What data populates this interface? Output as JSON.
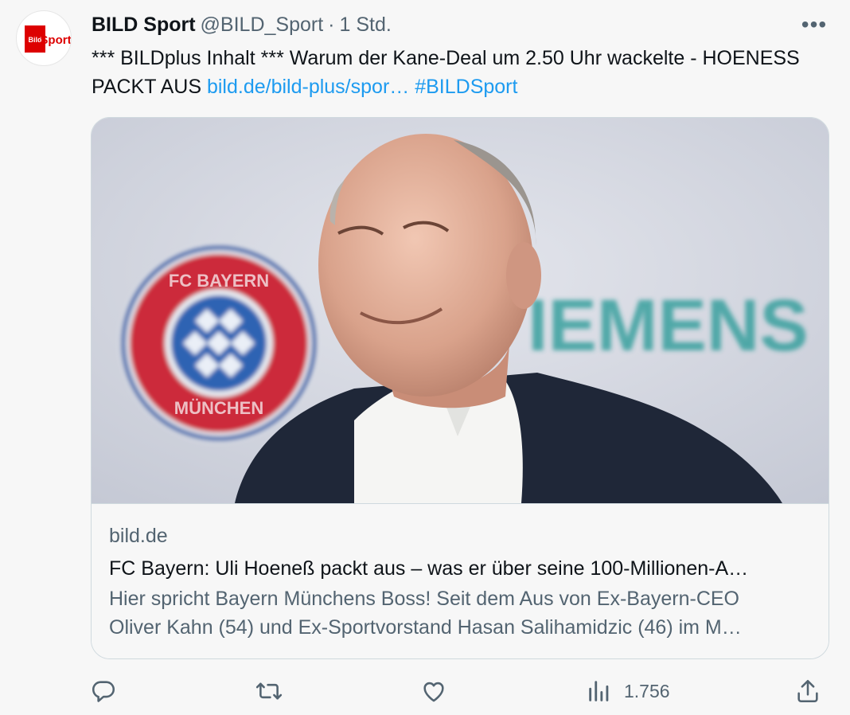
{
  "author": {
    "display_name": "BILD Sport",
    "handle": "@BILD_Sport",
    "separator": "·",
    "time": "1 Std.",
    "avatar_text": "Bild Sport"
  },
  "tweet": {
    "text_prefix": "*** BILDplus Inhalt *** Warum der Kane-Deal um 2.50 Uhr wackelte - HOENESS PACKT AUS ",
    "link": "bild.de/bild-plus/spor…",
    "hashtag": "#BILDSport"
  },
  "card": {
    "domain": "bild.de",
    "title": "FC Bayern: Uli Hoeneß packt aus – was er über seine 100-Millionen-A…",
    "description_line1": "Hier spricht Bayern Münchens Boss! Seit dem Aus von Ex-Bayern-CEO",
    "description_line2": "Oliver Kahn (54) und Ex-Sportvorstand Hasan Salihamidzic (46) im M…",
    "image_logo_text_top": "FC BAYERN",
    "image_logo_text_bottom": "MÜNCHEN",
    "image_sponsor_text": "IEMENS"
  },
  "actions": {
    "reply_icon": "reply-icon",
    "retweet_icon": "retweet-icon",
    "like_icon": "like-icon",
    "views_icon": "views-icon",
    "views_count": "1.756",
    "share_icon": "share-icon"
  },
  "colors": {
    "link": "#1d9bf0",
    "secondary_text": "#536471",
    "bild_red": "#dd0000"
  }
}
